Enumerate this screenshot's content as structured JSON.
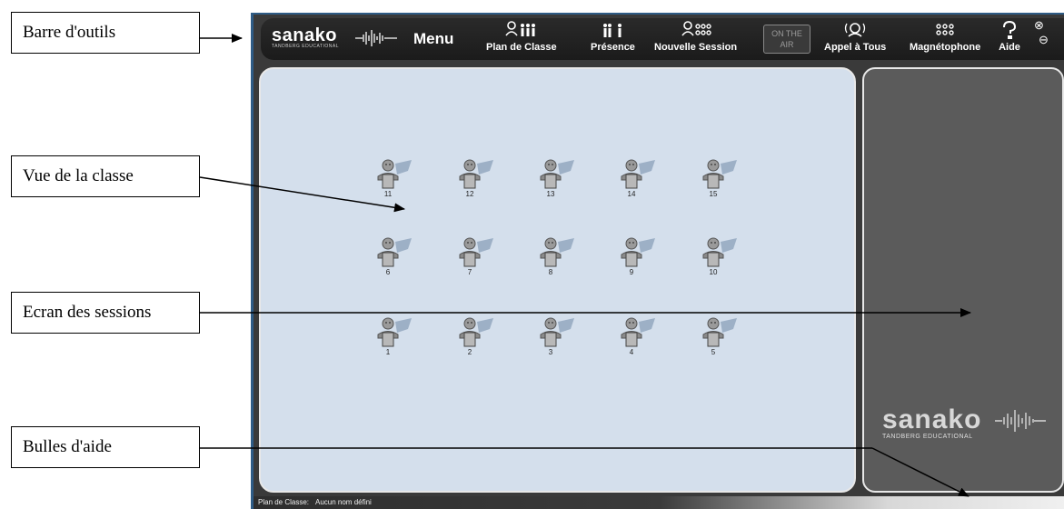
{
  "annotations": {
    "toolbar": "Barre d'outils",
    "class_view": "Vue de la classe",
    "session_screen": "Ecran des sessions",
    "help_bubbles": "Bulles d'aide"
  },
  "app": {
    "logo_word": "sanako",
    "logo_sub": "TANDBERG EDUCATIONAL",
    "menu_label": "Menu",
    "toolbar": {
      "plan": "Plan de Classe",
      "presence": "Présence",
      "new_session": "Nouvelle Session",
      "on_air_1": "ON THE",
      "on_air_2": "AIR",
      "call_all": "Appel à Tous",
      "recorder": "Magnétophone",
      "help": "Aide"
    },
    "close_glyph": "⊗",
    "minimize_glyph": "⊖",
    "seats": [
      "11",
      "12",
      "13",
      "14",
      "15",
      "6",
      "7",
      "8",
      "9",
      "10",
      "1",
      "2",
      "3",
      "4",
      "5"
    ],
    "session_logo_word": "sanako",
    "session_logo_sub": "TANDBERG EDUCATIONAL",
    "status_label": "Plan de Classe:",
    "status_value": "Aucun nom défini"
  },
  "colors": {
    "frame_accent": "#2f5c86",
    "classroom_bg": "#d4dfec",
    "sessions_bg": "#5b5b5b",
    "toolbar_bg": "#1b1b1b"
  },
  "icons": [
    "waveform-icon",
    "seating-plan-icon",
    "attendance-icon",
    "new-session-icon",
    "call-all-icon",
    "recorder-icon",
    "help-icon",
    "close-icon",
    "minimize-icon",
    "student-seat-icon"
  ]
}
